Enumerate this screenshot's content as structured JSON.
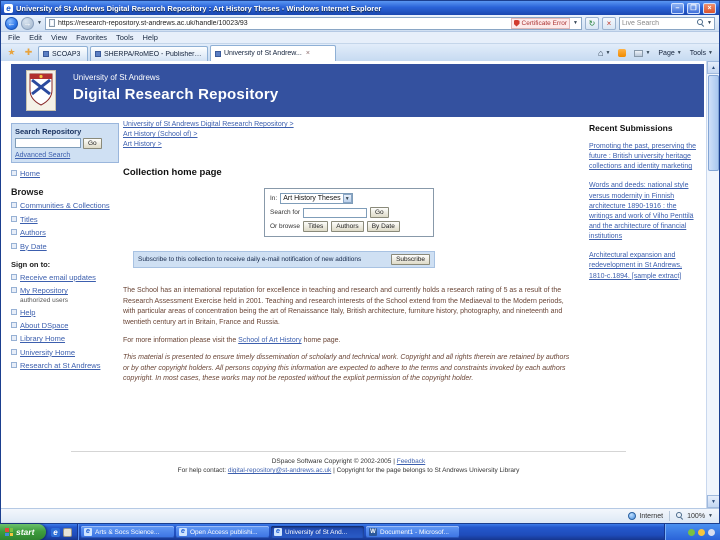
{
  "browser": {
    "title": "University of St Andrews Digital Research Repository : Art History Theses - Windows Internet Explorer",
    "url": "https://research-repository.st-andrews.ac.uk/handle/10023/93",
    "certificate_error": "Certificate Error",
    "search_value": "Live Search",
    "menu": [
      "File",
      "Edit",
      "View",
      "Favorites",
      "Tools",
      "Help"
    ],
    "tabs": [
      "SCOAP3",
      "SHERPA/RoMEO - Publisher c...",
      "University of St Andrew..."
    ],
    "page_button": "Page",
    "tools_button": "Tools",
    "status_zone": "Internet",
    "status_zoom": "100%"
  },
  "site": {
    "university": "University of St Andrews",
    "repository": "Digital Research Repository"
  },
  "sidebar": {
    "search_title": "Search Repository",
    "go": "Go",
    "advanced": "Advanced Search",
    "home": "Home",
    "browse_title": "Browse",
    "browse": [
      "Communities & Collections",
      "Titles",
      "Authors",
      "By Date"
    ],
    "signon_title": "Sign on to:",
    "signon": [
      "Receive email updates",
      "My Repository"
    ],
    "signon_note": "authorized users",
    "links": [
      "Help",
      "About DSpace",
      "Library Home",
      "University Home",
      "Research at St Andrews"
    ]
  },
  "breadcrumbs": [
    "University of St Andrews Digital Research Repository >",
    "Art History (School of) >",
    "Art History >"
  ],
  "collection": {
    "heading": "Collection home page",
    "in_label": "In:",
    "in_value": "Art History Theses",
    "for_label": "Search for",
    "go": "Go",
    "or_browse": "Or browse",
    "browse_buttons": [
      "Titles",
      "Authors",
      "By Date"
    ],
    "subscribe_text": "Subscribe to this collection to receive daily e-mail notification of new additions",
    "subscribe_button": "Subscribe",
    "description": "The School has an international reputation for excellence in teaching and research and currently holds a research rating of 5 as a result of the Research Assessment Exercise held in 2001. Teaching and research interests of the School extend from the Mediaeval to the Modern periods, with particular areas of concentration being the art of Renaissance Italy, British architecture, furniture history, photography, and nineteenth and twentieth century art in Britain, France and Russia.",
    "more_prefix": "For more information please visit the",
    "more_link": "School of Art History",
    "more_suffix": "home page.",
    "disclaimer": "This material is presented to ensure timely dissemination of scholarly and technical work. Copyright and all rights therein are retained by authors or by other copyright holders. All persons copying this information are expected to adhere to the terms and constraints invoked by each authors copyright. In most cases, these works may not be reposted without the explicit permission of the copyright holder."
  },
  "recent": {
    "title": "Recent Submissions",
    "items": [
      "Promoting the past, preserving the future : British university heritage collections and identity marketing",
      "Words and deeds: national style versus modernity in Finnish architecture 1890-1916 : the writings and work of Vilho Penttilä and the architecture of financial institutions",
      "Architectural expansion and redevelopment in St Andrews, 1810-c.1894. [sample extract]"
    ]
  },
  "footer": {
    "line1": "DSpace Software Copyright © 2002-2005 |",
    "line1_link": "Feedback",
    "line2_pre": "For help contact:",
    "line2_link": "digital-repository@st-andrews.ac.uk",
    "line2_post": "| Copyright for the page belongs to St Andrews University Library"
  },
  "taskbar": {
    "start": "start",
    "tasks": [
      "Arts & Socs Science...",
      "Open Access publishi...",
      "University of St And...",
      "Document1 - Microsof..."
    ]
  }
}
